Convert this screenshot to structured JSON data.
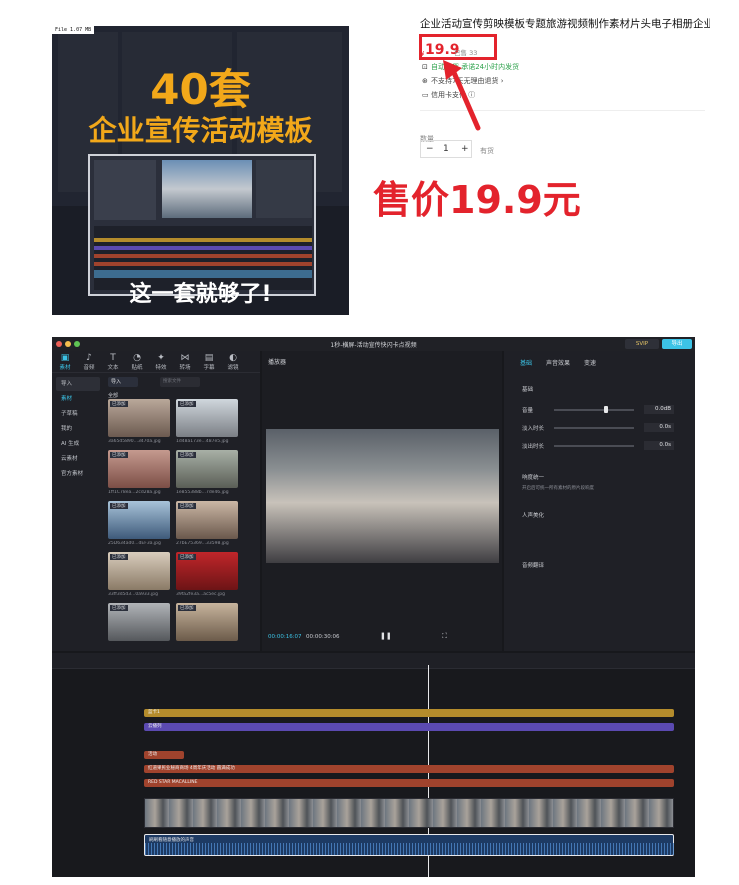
{
  "promo": {
    "file_tag": "File 1.07 MB",
    "headline": "40套",
    "subtitle": "企业宣传活动模板",
    "footer": "这一套就够了!"
  },
  "product": {
    "title": "企业活动宣传剪映模板专题旅游视频制作素材片头电子相册企业历程",
    "currency": "¥",
    "price": "19.9",
    "sold": "已售 33",
    "shipping": "自动发货 承诺24小时内发货",
    "service": "不支持7天无理由退货",
    "pay": "信用卡支付",
    "qty_label": "数量",
    "qty_minus": "−",
    "qty_value": "1",
    "qty_plus": "+",
    "stock": "有货"
  },
  "annotation": {
    "big_price": "售价19.9元",
    "arrow_color": "#e3232c"
  },
  "editor": {
    "window_title": "1秒-横屏-活动宣传快闪卡点视频",
    "vip_label": "SVIP",
    "export_label": "导出",
    "tools": [
      "素材",
      "音频",
      "文本",
      "贴纸",
      "特效",
      "转场",
      "字幕",
      "滤镜"
    ],
    "categories": [
      "导入",
      "素材",
      "子草稿",
      "我的",
      "AI 生成",
      "云素材",
      "官方素材"
    ],
    "import_btn": "导入",
    "search_placeholder": "搜索文件",
    "all_label": "全部",
    "added_label": "已添加",
    "thumbs": [
      "3a65d5890...3470a.jpg",
      "1d48a173e...487e5.jpg",
      "1ff1C78ea...2cd28a.jpg",
      "1e855388b...7de46.jpg",
      "25D634ad0...dEF3a.jpg",
      "27bE75369...33598.jpg",
      "33ff3d5d3...0a933.jpg",
      "39fa2fe3a...ac5ec.jpg"
    ],
    "player_title": "播放器",
    "timecode_current": "00:00:16:07",
    "timecode_total": "00:00:30:06",
    "right_tabs": [
      "基础",
      "声音效果",
      "变速"
    ],
    "basic_label": "基础",
    "volume_label": "音量",
    "volume_value": "0.0dB",
    "fadein_label": "淡入时长",
    "fadein_value": "0.0s",
    "fadeout_label": "淡出时长",
    "fadeout_value": "0.0s",
    "loudness_label": "响度统一",
    "loudness_desc": "开启后可统一所有素材的原片段响度",
    "voice_label": "人声美化",
    "translate_label": "音频翻译",
    "tracks": {
      "t1": "蓝卡1",
      "t2": "云播列",
      "text1": "活动",
      "text2": "红道果民业秘商商场 4周年庆活动 圆满成功",
      "text3": "RED STAR MACALLINE",
      "audio": "刷刷看随意播放的声音"
    },
    "colors": {
      "accent": "#3cc3e6",
      "gold_track": "#b48c2c",
      "purple_track": "#5b4ab1",
      "text_track": "#a0432d"
    }
  }
}
